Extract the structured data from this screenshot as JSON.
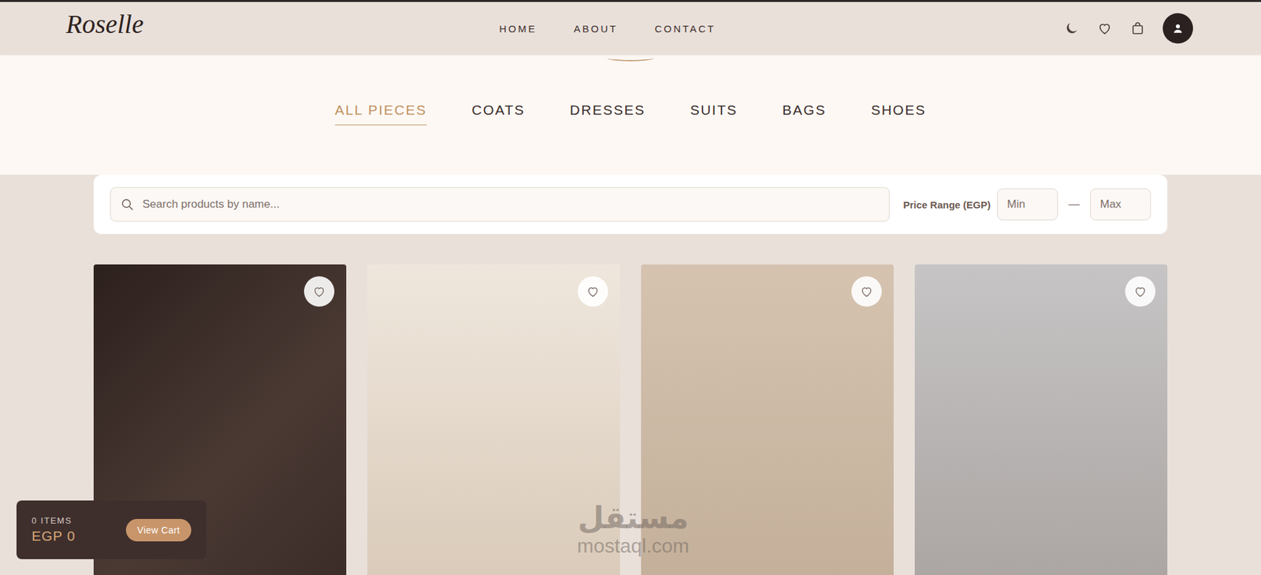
{
  "header": {
    "logo": "Roselle",
    "nav": [
      "HOME",
      "ABOUT",
      "CONTACT"
    ]
  },
  "categories": [
    {
      "label": "ALL PIECES",
      "selected": true
    },
    {
      "label": "COATS",
      "selected": false
    },
    {
      "label": "DRESSES",
      "selected": false
    },
    {
      "label": "SUITS",
      "selected": false
    },
    {
      "label": "BAGS",
      "selected": false
    },
    {
      "label": "SHOES",
      "selected": false
    }
  ],
  "search": {
    "placeholder": "Search products by name..."
  },
  "price": {
    "label": "Price Range (EGP)",
    "min_placeholder": "Min",
    "separator": "—",
    "max_placeholder": "Max"
  },
  "products": [
    {
      "favorite": false
    },
    {
      "favorite": false
    },
    {
      "favorite": false
    },
    {
      "favorite": false
    }
  ],
  "cart": {
    "count": "0 ITEMS",
    "total": "EGP 0",
    "button": "View Cart"
  },
  "watermark": {
    "arabic": "مستقل",
    "latin": "mostaql.com"
  }
}
